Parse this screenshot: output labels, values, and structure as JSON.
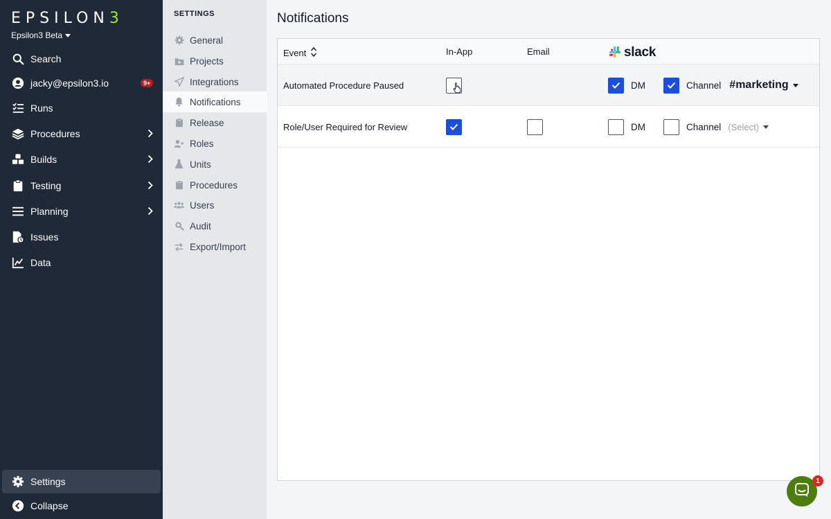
{
  "brand": {
    "logo_main": "EPSILON",
    "logo_accent": "3",
    "workspace": "Epsilon3 Beta"
  },
  "sidebar": {
    "items": [
      {
        "label": "Search",
        "icon": "search-icon"
      },
      {
        "label": "jacky@epsilon3.io",
        "icon": "user-circle-icon",
        "badge": "9+"
      },
      {
        "label": "Runs",
        "icon": "checklist-icon"
      },
      {
        "label": "Procedures",
        "icon": "layers-icon"
      },
      {
        "label": "Builds",
        "icon": "cubes-icon"
      },
      {
        "label": "Testing",
        "icon": "clipboard-icon"
      },
      {
        "label": "Planning",
        "icon": "bars-icon"
      },
      {
        "label": "Issues",
        "icon": "file-clock-icon"
      },
      {
        "label": "Data",
        "icon": "line-chart-icon"
      }
    ],
    "settings_label": "Settings",
    "collapse_label": "Collapse"
  },
  "submenu": {
    "title": "SETTINGS",
    "items": [
      {
        "label": "General",
        "icon": "gear-icon"
      },
      {
        "label": "Projects",
        "icon": "folder-plus-icon"
      },
      {
        "label": "Integrations",
        "icon": "paper-plane-icon"
      },
      {
        "label": "Notifications",
        "icon": "bell-icon",
        "active": true
      },
      {
        "label": "Release",
        "icon": "clipboard-icon"
      },
      {
        "label": "Roles",
        "icon": "user-plus-icon"
      },
      {
        "label": "Units",
        "icon": "flask-icon"
      },
      {
        "label": "Procedures",
        "icon": "clipboard-icon"
      },
      {
        "label": "Users",
        "icon": "users-icon"
      },
      {
        "label": "Audit",
        "icon": "search-magnify-icon"
      },
      {
        "label": "Export/Import",
        "icon": "arrows-swap-icon"
      }
    ]
  },
  "main": {
    "title": "Notifications",
    "columns": {
      "event": "Event",
      "in_app": "In-App",
      "email": "Email",
      "slack": "slack"
    },
    "rows": [
      {
        "event": "Automated Procedure Paused",
        "in_app": false,
        "email": null,
        "dm": true,
        "dm_label": "DM",
        "channel": true,
        "channel_label": "Channel",
        "channel_value": "#marketing"
      },
      {
        "event": "Role/User Required for Review",
        "in_app": true,
        "email": false,
        "dm": false,
        "dm_label": "DM",
        "channel": false,
        "channel_label": "Channel",
        "channel_placeholder": "(Select)"
      }
    ]
  },
  "chat": {
    "badge": "1"
  },
  "colors": {
    "sidebar_bg": "#1f2937",
    "accent": "#a3e635",
    "checkbox_blue": "#1d4ed8",
    "badge_red": "#b91c1c",
    "chat_green": "#4d7c0f"
  }
}
